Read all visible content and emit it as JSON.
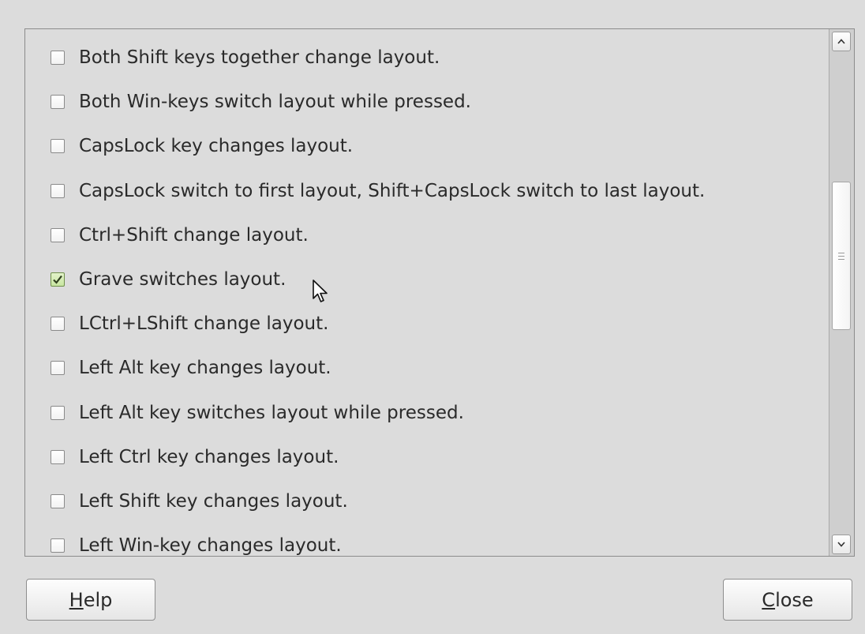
{
  "options": [
    {
      "label": "Both Shift keys together change layout.",
      "checked": false
    },
    {
      "label": "Both Win-keys switch layout while pressed.",
      "checked": false
    },
    {
      "label": "CapsLock key changes layout.",
      "checked": false
    },
    {
      "label": "CapsLock switch to first layout, Shift+CapsLock switch to last layout.",
      "checked": false
    },
    {
      "label": "Ctrl+Shift change layout.",
      "checked": false
    },
    {
      "label": "Grave switches layout.",
      "checked": true
    },
    {
      "label": "LCtrl+LShift change layout.",
      "checked": false
    },
    {
      "label": "Left Alt key changes layout.",
      "checked": false
    },
    {
      "label": "Left Alt key switches layout while pressed.",
      "checked": false
    },
    {
      "label": "Left Ctrl key changes layout.",
      "checked": false
    },
    {
      "label": "Left Shift key changes layout.",
      "checked": false
    },
    {
      "label": "Left Win-key changes layout.",
      "checked": false
    }
  ],
  "buttons": {
    "help": {
      "mnemonic": "H",
      "rest": "elp"
    },
    "close": {
      "mnemonic": "C",
      "rest": "lose"
    }
  },
  "colors": {
    "checked_fill": "#c8e6a2",
    "checkmark": "#2f3f1f"
  },
  "icons": {
    "scroll_up": "chevron-up-icon",
    "scroll_down": "chevron-down-icon",
    "thumb_grip": "grip-icon",
    "cursor": "mouse-pointer-icon"
  }
}
